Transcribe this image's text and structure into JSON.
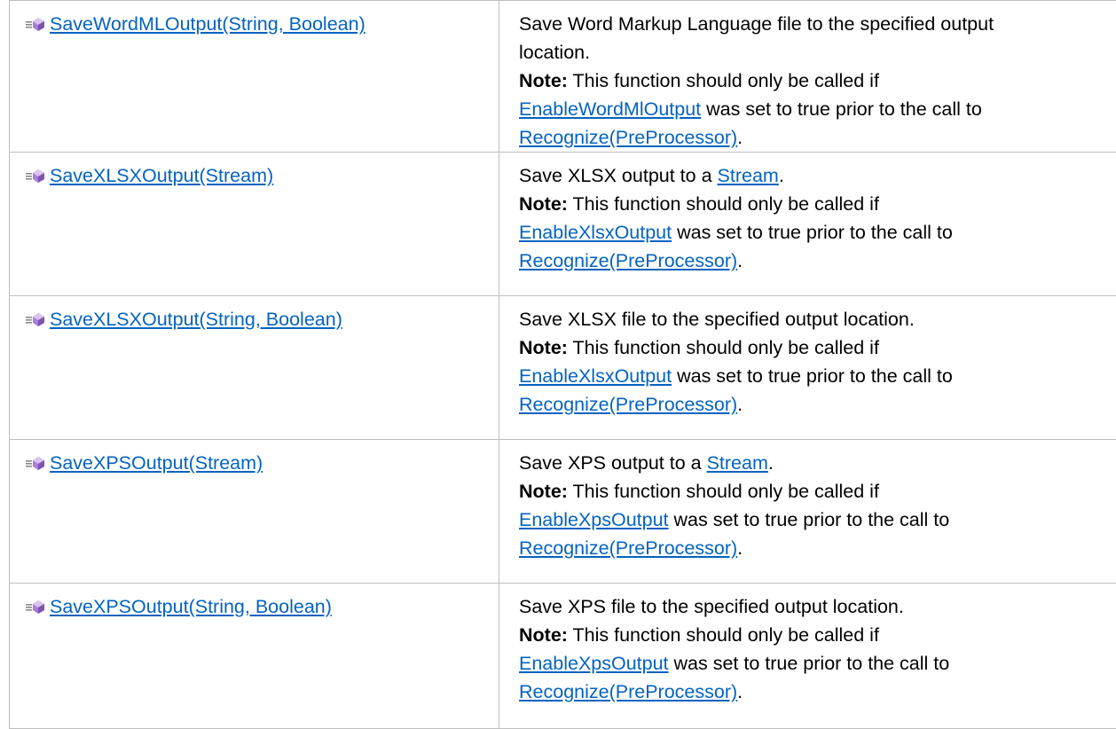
{
  "colors": {
    "link": "#0563c1",
    "border": "#bfbfbf",
    "icon_accent": "#b087e0"
  },
  "icon_name": "public-method-icon",
  "rows": [
    {
      "name": "SaveWordMLOutput(String, Boolean)",
      "lines": [
        {
          "text": "Save Word Markup Language file to the specified output"
        },
        {
          "text": "location."
        },
        {
          "note": "Note:",
          "text": " This function should only be called if"
        },
        {
          "link": "EnableWordMlOutput",
          "text": " was set to true prior to the call to"
        },
        {
          "link": "Recognize(PreProcessor)",
          "text": "."
        }
      ]
    },
    {
      "name": "SaveXLSXOutput(Stream)",
      "lines": [
        {
          "text": "Save XLSX output to a ",
          "link": "Stream",
          "after": "."
        },
        {
          "note": "Note:",
          "text": " This function should only be called if"
        },
        {
          "link": "EnableXlsxOutput",
          "text": " was set to true prior to the call to"
        },
        {
          "link": "Recognize(PreProcessor)",
          "text": "."
        }
      ]
    },
    {
      "name": "SaveXLSXOutput(String, Boolean)",
      "lines": [
        {
          "text": "Save XLSX file to the specified output location."
        },
        {
          "note": "Note:",
          "text": " This function should only be called if"
        },
        {
          "link": "EnableXlsxOutput",
          "text": " was set to true prior to the call to"
        },
        {
          "link": "Recognize(PreProcessor)",
          "text": "."
        }
      ]
    },
    {
      "name": "SaveXPSOutput(Stream)",
      "lines": [
        {
          "text": "Save XPS output to a ",
          "link": "Stream",
          "after": "."
        },
        {
          "note": "Note:",
          "text": " This function should only be called if"
        },
        {
          "link": "EnableXpsOutput",
          "text": " was set to true prior to the call to"
        },
        {
          "link": "Recognize(PreProcessor)",
          "text": "."
        }
      ]
    },
    {
      "name": "SaveXPSOutput(String, Boolean)",
      "lines": [
        {
          "text": "Save XPS file to the specified output location."
        },
        {
          "note": "Note:",
          "text": " This function should only be called if"
        },
        {
          "link": "EnableXpsOutput",
          "text": " was set to true prior to the call to"
        },
        {
          "link": "Recognize(PreProcessor)",
          "text": "."
        }
      ]
    }
  ]
}
